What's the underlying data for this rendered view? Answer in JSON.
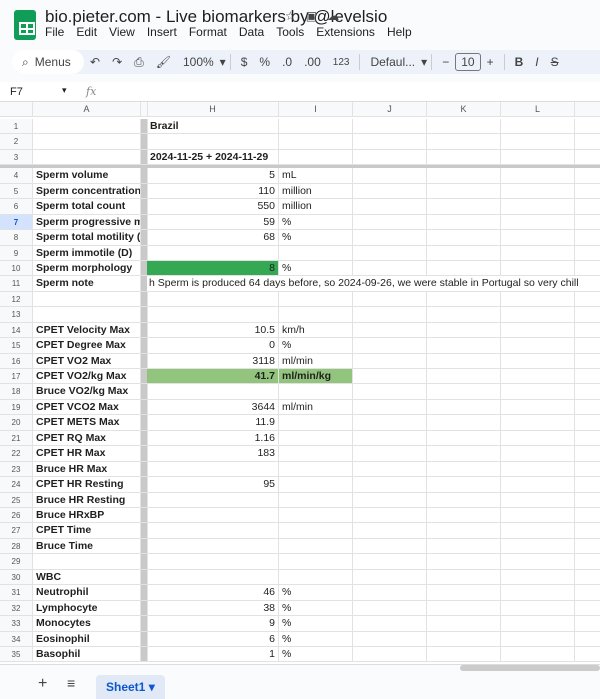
{
  "title": "bio.pieter.com - Live biomarkers by @levelsio",
  "menu": [
    "File",
    "Edit",
    "View",
    "Insert",
    "Format",
    "Data",
    "Tools",
    "Extensions",
    "Help"
  ],
  "toolbar": {
    "search": "Menus",
    "zoom": "100%",
    "currency": "$",
    "percent": "%",
    "dec_less": ".0",
    "dec_more": ".00",
    "format123": "123",
    "font": "Defaul...",
    "font_size": "10"
  },
  "cell_ref": "F7",
  "fx": "fx",
  "columns": [
    "A",
    "H",
    "I",
    "J",
    "K",
    "L"
  ],
  "rows": [
    {
      "n": "1",
      "a": "",
      "h": "Brazil",
      "i": ""
    },
    {
      "n": "2",
      "a": "",
      "h": "",
      "i": ""
    },
    {
      "n": "3",
      "a": "",
      "h": "2024-11-25 + 2024-11-29",
      "i": ""
    },
    {
      "n": "4",
      "a": "Sperm volume",
      "h": "5",
      "i": "mL"
    },
    {
      "n": "5",
      "a": "Sperm concentration",
      "h": "110",
      "i": "million"
    },
    {
      "n": "6",
      "a": "Sperm total count",
      "h": "550",
      "i": "million"
    },
    {
      "n": "7",
      "a": "Sperm progressive motility",
      "h": "59",
      "i": "%"
    },
    {
      "n": "8",
      "a": "Sperm total motility (A+B+C)",
      "h": "68",
      "i": "%"
    },
    {
      "n": "9",
      "a": "Sperm immotile (D)",
      "h": "",
      "i": ""
    },
    {
      "n": "10",
      "a": "Sperm morphology",
      "h": "8",
      "i": "%"
    },
    {
      "n": "11",
      "a": "Sperm note",
      "h": "",
      "i": ""
    },
    {
      "n": "12",
      "a": "",
      "h": "",
      "i": ""
    },
    {
      "n": "13",
      "a": "",
      "h": "",
      "i": ""
    },
    {
      "n": "14",
      "a": "CPET Velocity Max",
      "h": "10.5",
      "i": "km/h"
    },
    {
      "n": "15",
      "a": "CPET Degree Max",
      "h": "0",
      "i": "%"
    },
    {
      "n": "16",
      "a": "CPET VO2 Max",
      "h": "3118",
      "i": "ml/min"
    },
    {
      "n": "17",
      "a": "CPET VO2/kg Max",
      "h": "41.7",
      "i": "ml/min/kg"
    },
    {
      "n": "18",
      "a": "Bruce VO2/kg Max",
      "h": "",
      "i": ""
    },
    {
      "n": "19",
      "a": "CPET VCO2 Max",
      "h": "3644",
      "i": "ml/min"
    },
    {
      "n": "20",
      "a": "CPET METS Max",
      "h": "11.9",
      "i": ""
    },
    {
      "n": "21",
      "a": "CPET RQ Max",
      "h": "1.16",
      "i": ""
    },
    {
      "n": "22",
      "a": "CPET HR Max",
      "h": "183",
      "i": ""
    },
    {
      "n": "23",
      "a": "Bruce HR Max",
      "h": "",
      "i": ""
    },
    {
      "n": "24",
      "a": "CPET HR Resting",
      "h": "95",
      "i": ""
    },
    {
      "n": "25",
      "a": "Bruce HR Resting",
      "h": "",
      "i": ""
    },
    {
      "n": "26",
      "a": "Bruce HRxBP",
      "h": "",
      "i": ""
    },
    {
      "n": "27",
      "a": "CPET Time",
      "h": "",
      "i": ""
    },
    {
      "n": "28",
      "a": "Bruce Time",
      "h": "",
      "i": ""
    },
    {
      "n": "29",
      "a": "",
      "h": "",
      "i": ""
    },
    {
      "n": "30",
      "a": "WBC",
      "h": "",
      "i": ""
    },
    {
      "n": "31",
      "a": "Neutrophil",
      "h": "46",
      "i": "%"
    },
    {
      "n": "32",
      "a": "Lymphocyte",
      "h": "38",
      "i": "%"
    },
    {
      "n": "33",
      "a": "Monocytes",
      "h": "9",
      "i": "%"
    },
    {
      "n": "34",
      "a": "Eosinophil",
      "h": "6",
      "i": "%"
    },
    {
      "n": "35",
      "a": "Basophil",
      "h": "1",
      "i": "%"
    }
  ],
  "sperm_note_overflow": "h Sperm is produced 64 days before, so 2024-09-26, we were stable in Portugal so very chill",
  "colors": {
    "morphology": "#34a853",
    "vo2kg": "#93c47d"
  },
  "sheet_tab": "Sheet1"
}
